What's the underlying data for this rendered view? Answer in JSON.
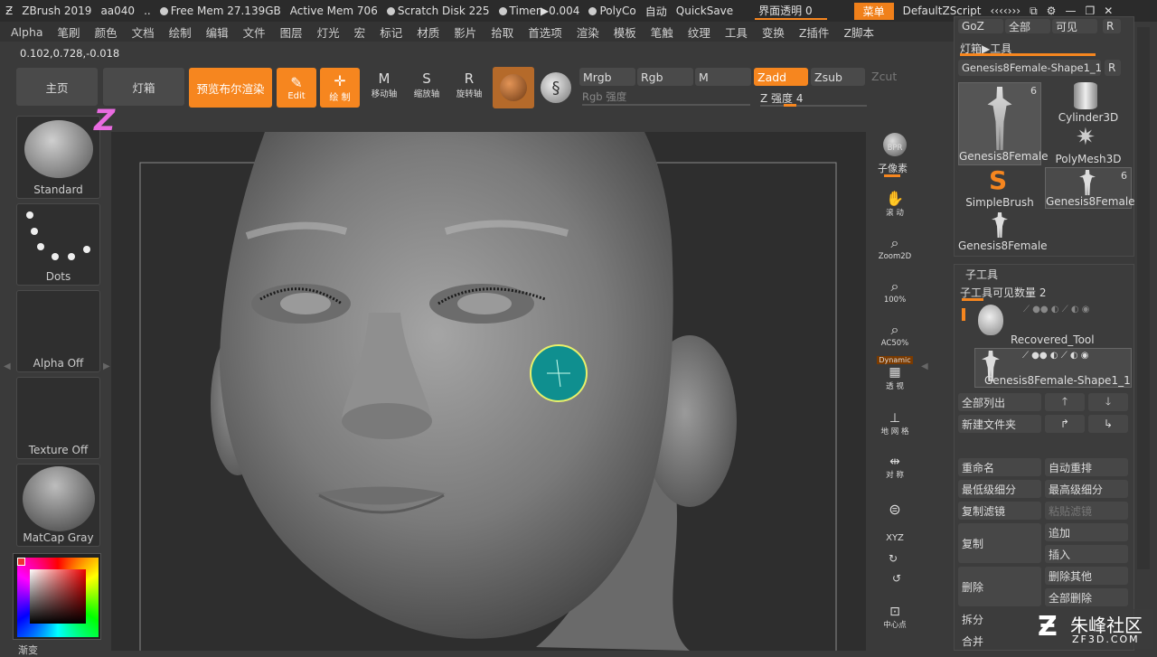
{
  "titlebar": {
    "app": "ZBrush 2019",
    "doc": "aa040",
    "ellipsis": "..",
    "free_mem": "Free Mem 27.139GB",
    "active_mem": "Active Mem 706",
    "scratch": "Scratch Disk 225",
    "timer": "Timer▶0.004",
    "polycount": "PolyCo",
    "auto": "自动",
    "quicksave": "QuickSave",
    "transparency": "界面透明 0",
    "menu_btn": "菜单",
    "script": "DefaultZScript"
  },
  "menubar": [
    "Alpha",
    "笔刷",
    "颜色",
    "文档",
    "绘制",
    "编辑",
    "文件",
    "图层",
    "灯光",
    "宏",
    "标记",
    "材质",
    "影片",
    "拾取",
    "首选项",
    "渲染",
    "模板",
    "笔触",
    "纹理",
    "工具",
    "变换",
    "Z插件",
    "Z脚本"
  ],
  "coords": "0.102,0.728,-0.018",
  "toolbar": {
    "home": "主页",
    "lightbox": "灯箱",
    "bpr": "预览布尔渲染",
    "edit": "Edit",
    "draw": "绘 制",
    "move": "移动轴",
    "scale": "缩放轴",
    "rotate": "旋转轴",
    "mrgb": "Mrgb",
    "rgb": "Rgb",
    "m": "M",
    "zadd": "Zadd",
    "zsub": "Zsub",
    "zcut": "Zcut",
    "rgb_intensity": "Rgb 强度",
    "z_intensity": "Z 强度 4"
  },
  "left": {
    "brush": "Standard",
    "stroke": "Dots",
    "alpha": "Alpha Off",
    "texture": "Texture Off",
    "material": "MatCap Gray",
    "gradient": "渐变"
  },
  "right_tools": {
    "bpr": "BPR",
    "subpixel": "子像素",
    "scroll": "滚 动",
    "zoom2d": "Zoom2D",
    "p100": "100%",
    "ac50": "AC50%",
    "dynamic": "Dynamic",
    "persp": "透 视",
    "floor": "地 网 格",
    "sym": "对 称",
    "xyz": "XYZ",
    "center": "中心点"
  },
  "panel": {
    "goz": "GoZ",
    "all": "全部",
    "visible": "可见",
    "r": "R",
    "lightbox_tool": "灯箱▶工具",
    "current_tool": "Genesis8Female-Shape1_1.",
    "tools": [
      {
        "name": "Genesis8Female",
        "count": "6"
      },
      {
        "name": "Cylinder3D",
        "count": ""
      },
      {
        "name": "PolyMesh3D",
        "count": ""
      },
      {
        "name": "SimpleBrush",
        "count": ""
      },
      {
        "name": "Genesis8Female",
        "count": "6"
      },
      {
        "name": "Genesis8Female",
        "count": ""
      }
    ],
    "subtool_title": "子工具",
    "visible_count": "子工具可见数量 2",
    "subtools": [
      "Recovered_Tool",
      "Genesis8Female-Shape1_1"
    ],
    "list_all": "全部列出",
    "new_folder": "新建文件夹",
    "rename": "重命名",
    "auto_reorder": "自动重排",
    "lowest": "最低级细分",
    "highest": "最高级细分",
    "copy_filter": "复制滤镜",
    "paste_filter": "粘贴滤镜",
    "duplicate": "复制",
    "append": "追加",
    "insert": "插入",
    "delete": "删除",
    "delete_other": "删除其他",
    "delete_all": "全部删除",
    "split": "拆分",
    "merge": "合并"
  },
  "watermark": {
    "cn": "朱峰社区",
    "url": "ZF3D.COM"
  },
  "colors": {
    "accent": "#f6861f",
    "panel": "#3c3c3c",
    "canvas": "#2e2e2e",
    "brush_cursor": "#0f8f8f"
  }
}
